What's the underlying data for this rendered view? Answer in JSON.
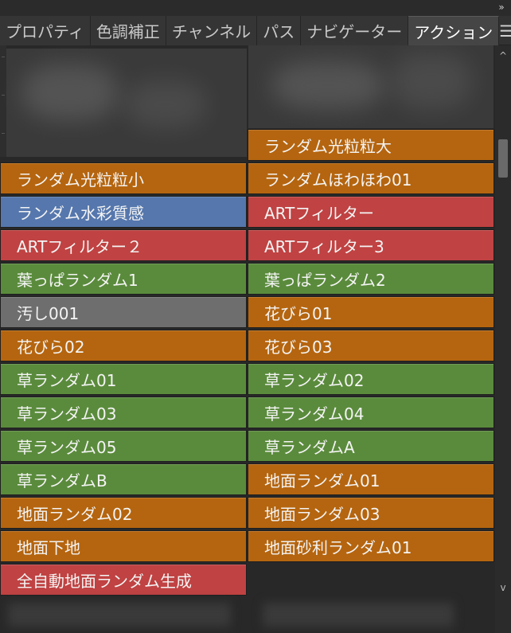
{
  "window": {
    "collapse_glyph": "»"
  },
  "tabs": [
    {
      "label": "プロパティ",
      "active": false
    },
    {
      "label": "色調補正",
      "active": false
    },
    {
      "label": "チャンネル",
      "active": false
    },
    {
      "label": "パス",
      "active": false
    },
    {
      "label": "ナビゲーター",
      "active": false
    },
    {
      "label": "アクション",
      "active": true
    }
  ],
  "panel_menu_glyph": "☰",
  "colors": {
    "orange": "#b5650f",
    "blue": "#5577ad",
    "red": "#c04242",
    "green": "#5a8b3c",
    "gray": "#6e6e6e"
  },
  "actions_left": [
    {
      "label": "ランダム光粒粒小",
      "color": "orange"
    },
    {
      "label": "ランダム水彩質感",
      "color": "blue"
    },
    {
      "label": "ARTフィルター２",
      "color": "red"
    },
    {
      "label": "葉っぱランダム1",
      "color": "green"
    },
    {
      "label": "汚し001",
      "color": "gray"
    },
    {
      "label": "花びら02",
      "color": "orange"
    },
    {
      "label": "草ランダム01",
      "color": "green"
    },
    {
      "label": "草ランダム03",
      "color": "green"
    },
    {
      "label": "草ランダム05",
      "color": "green"
    },
    {
      "label": "草ランダムB",
      "color": "green"
    },
    {
      "label": "地面ランダム02",
      "color": "orange"
    },
    {
      "label": "地面下地",
      "color": "orange"
    },
    {
      "label": "全自動地面ランダム生成",
      "color": "red"
    }
  ],
  "actions_right": [
    {
      "label": "ランダム光粒粒大",
      "color": "orange"
    },
    {
      "label": "ランダムほわほわ01",
      "color": "orange"
    },
    {
      "label": "ARTフィルター",
      "color": "red"
    },
    {
      "label": "ARTフィルター3",
      "color": "red"
    },
    {
      "label": "葉っぱランダム2",
      "color": "green"
    },
    {
      "label": "花びら01",
      "color": "orange"
    },
    {
      "label": "花びら03",
      "color": "orange"
    },
    {
      "label": "草ランダム02",
      "color": "green"
    },
    {
      "label": "草ランダム04",
      "color": "green"
    },
    {
      "label": "草ランダムA",
      "color": "green"
    },
    {
      "label": "地面ランダム01",
      "color": "orange"
    },
    {
      "label": "地面ランダム03",
      "color": "orange"
    },
    {
      "label": "地面砂利ランダム01",
      "color": "orange"
    }
  ],
  "scrollbar": {
    "up_glyph": "^",
    "down_glyph": "v"
  }
}
